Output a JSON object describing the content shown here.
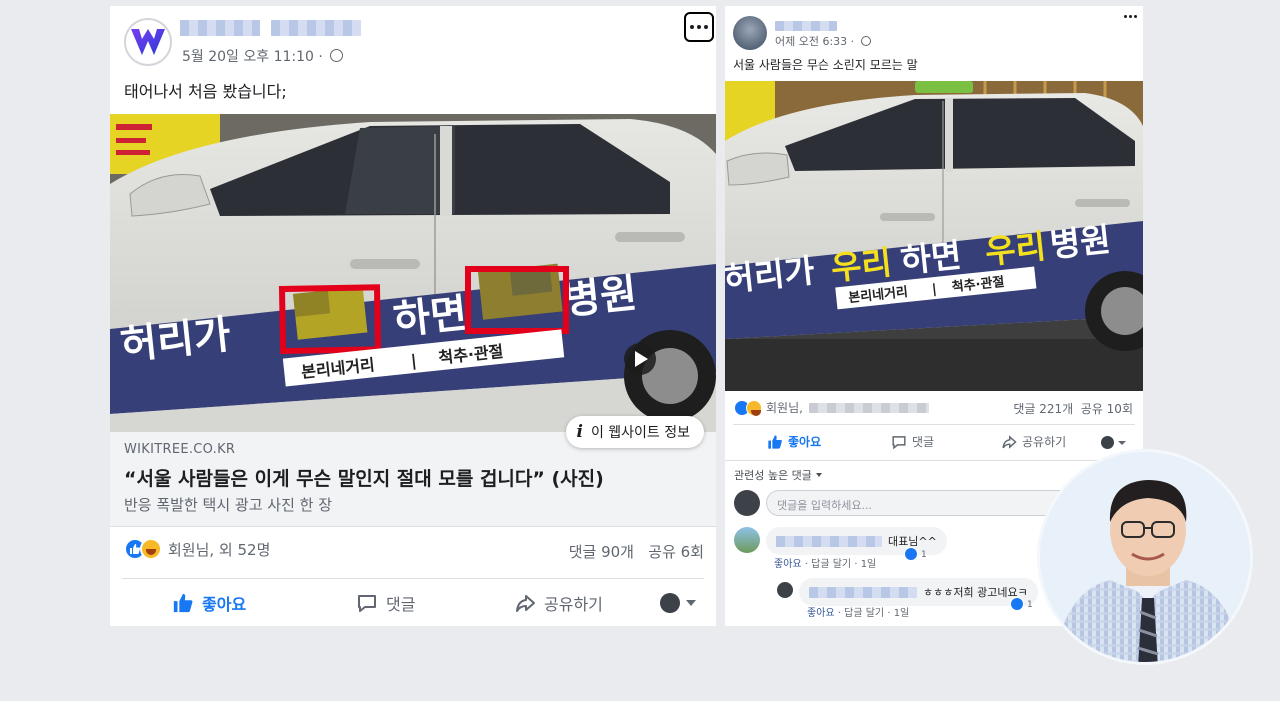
{
  "left_post": {
    "timestamp": "5월 20일 오후 11:10 ·",
    "text": "태어나서 처음 봤습니다;",
    "link": {
      "info_badge": "이 웹사이트 정보",
      "domain": "WIKITREE.CO.KR",
      "title": "“서울 사람들은 이게 무슨 말인지 절대 모를 겁니다” (사진)",
      "subtitle": "반응 폭발한 택시 광고 사진 한 장"
    },
    "reactions": {
      "summary": "회원님, 외 52명",
      "stats": "댓글 90개   공유 6회"
    },
    "actions": {
      "like": "좋아요",
      "comment": "댓글",
      "share": "공유하기"
    }
  },
  "taxi_ad": {
    "slogan_prefix": "허리가 ",
    "slogan_word_1": "우리",
    "slogan_mid": "하면 ",
    "slogan_word_2": "우리",
    "slogan_suffix": "병원",
    "location_1": "본리네거리",
    "separator": "|",
    "location_2": "척추·관절"
  },
  "right_post": {
    "timestamp": "어제 오전 6:33 ·",
    "text": "서울 사람들은 무슨 소린지 모르는 말",
    "reactions": {
      "summary": "회원님,",
      "stats": "댓글 221개  공유 10회"
    },
    "actions": {
      "like": "좋아요",
      "comment": "댓글",
      "share": "공유하기"
    },
    "sort_label": "관련성 높은 댓글",
    "comment_placeholder": "댓글을 입력하세요...",
    "comments": [
      {
        "text": "대표님^^",
        "like_label": "좋아요",
        "reply_label": "답글 달기",
        "age": "1일",
        "likes": "1"
      },
      {
        "text": "ㅎㅎㅎ저희 광고네요ㅋ",
        "like_label": "좋아요",
        "reply_label": "답글 달기",
        "age": "1일",
        "likes": "1"
      }
    ]
  },
  "colors": {
    "facebook_blue": "#1877f2",
    "highlight_red": "#e3001b",
    "taxi_band": "#363f78",
    "slogan_yellow": "#f5e01e"
  }
}
